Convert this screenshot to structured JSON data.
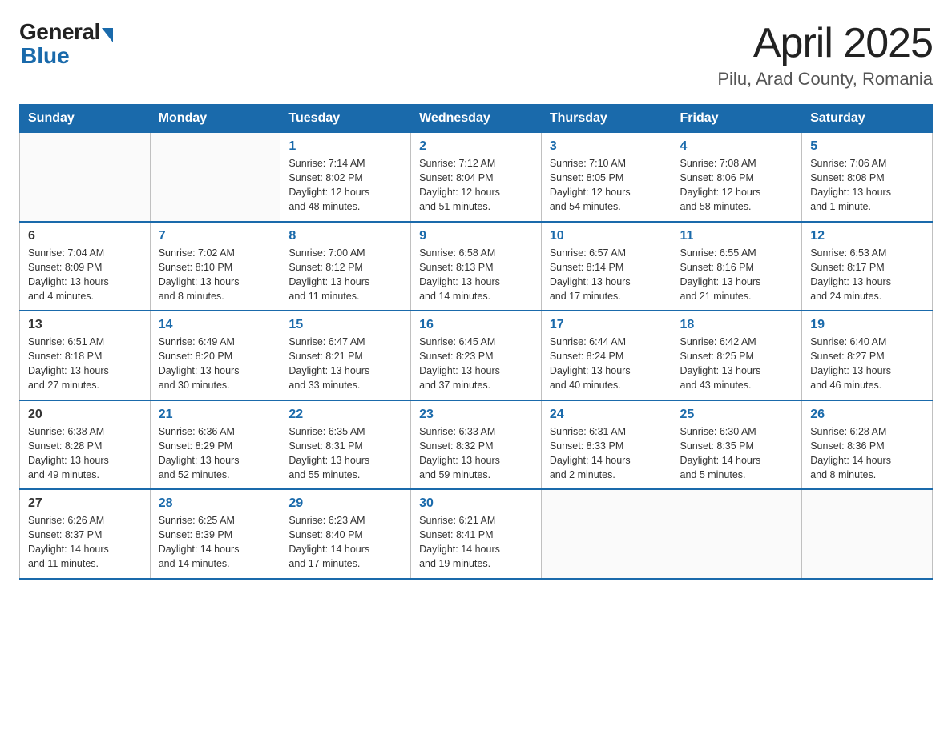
{
  "header": {
    "logo_general": "General",
    "logo_blue": "Blue",
    "month_title": "April 2025",
    "location": "Pilu, Arad County, Romania"
  },
  "days_of_week": [
    "Sunday",
    "Monday",
    "Tuesday",
    "Wednesday",
    "Thursday",
    "Friday",
    "Saturday"
  ],
  "weeks": [
    [
      {
        "day": "",
        "info": ""
      },
      {
        "day": "",
        "info": ""
      },
      {
        "day": "1",
        "info": "Sunrise: 7:14 AM\nSunset: 8:02 PM\nDaylight: 12 hours\nand 48 minutes."
      },
      {
        "day": "2",
        "info": "Sunrise: 7:12 AM\nSunset: 8:04 PM\nDaylight: 12 hours\nand 51 minutes."
      },
      {
        "day": "3",
        "info": "Sunrise: 7:10 AM\nSunset: 8:05 PM\nDaylight: 12 hours\nand 54 minutes."
      },
      {
        "day": "4",
        "info": "Sunrise: 7:08 AM\nSunset: 8:06 PM\nDaylight: 12 hours\nand 58 minutes."
      },
      {
        "day": "5",
        "info": "Sunrise: 7:06 AM\nSunset: 8:08 PM\nDaylight: 13 hours\nand 1 minute."
      }
    ],
    [
      {
        "day": "6",
        "info": "Sunrise: 7:04 AM\nSunset: 8:09 PM\nDaylight: 13 hours\nand 4 minutes."
      },
      {
        "day": "7",
        "info": "Sunrise: 7:02 AM\nSunset: 8:10 PM\nDaylight: 13 hours\nand 8 minutes."
      },
      {
        "day": "8",
        "info": "Sunrise: 7:00 AM\nSunset: 8:12 PM\nDaylight: 13 hours\nand 11 minutes."
      },
      {
        "day": "9",
        "info": "Sunrise: 6:58 AM\nSunset: 8:13 PM\nDaylight: 13 hours\nand 14 minutes."
      },
      {
        "day": "10",
        "info": "Sunrise: 6:57 AM\nSunset: 8:14 PM\nDaylight: 13 hours\nand 17 minutes."
      },
      {
        "day": "11",
        "info": "Sunrise: 6:55 AM\nSunset: 8:16 PM\nDaylight: 13 hours\nand 21 minutes."
      },
      {
        "day": "12",
        "info": "Sunrise: 6:53 AM\nSunset: 8:17 PM\nDaylight: 13 hours\nand 24 minutes."
      }
    ],
    [
      {
        "day": "13",
        "info": "Sunrise: 6:51 AM\nSunset: 8:18 PM\nDaylight: 13 hours\nand 27 minutes."
      },
      {
        "day": "14",
        "info": "Sunrise: 6:49 AM\nSunset: 8:20 PM\nDaylight: 13 hours\nand 30 minutes."
      },
      {
        "day": "15",
        "info": "Sunrise: 6:47 AM\nSunset: 8:21 PM\nDaylight: 13 hours\nand 33 minutes."
      },
      {
        "day": "16",
        "info": "Sunrise: 6:45 AM\nSunset: 8:23 PM\nDaylight: 13 hours\nand 37 minutes."
      },
      {
        "day": "17",
        "info": "Sunrise: 6:44 AM\nSunset: 8:24 PM\nDaylight: 13 hours\nand 40 minutes."
      },
      {
        "day": "18",
        "info": "Sunrise: 6:42 AM\nSunset: 8:25 PM\nDaylight: 13 hours\nand 43 minutes."
      },
      {
        "day": "19",
        "info": "Sunrise: 6:40 AM\nSunset: 8:27 PM\nDaylight: 13 hours\nand 46 minutes."
      }
    ],
    [
      {
        "day": "20",
        "info": "Sunrise: 6:38 AM\nSunset: 8:28 PM\nDaylight: 13 hours\nand 49 minutes."
      },
      {
        "day": "21",
        "info": "Sunrise: 6:36 AM\nSunset: 8:29 PM\nDaylight: 13 hours\nand 52 minutes."
      },
      {
        "day": "22",
        "info": "Sunrise: 6:35 AM\nSunset: 8:31 PM\nDaylight: 13 hours\nand 55 minutes."
      },
      {
        "day": "23",
        "info": "Sunrise: 6:33 AM\nSunset: 8:32 PM\nDaylight: 13 hours\nand 59 minutes."
      },
      {
        "day": "24",
        "info": "Sunrise: 6:31 AM\nSunset: 8:33 PM\nDaylight: 14 hours\nand 2 minutes."
      },
      {
        "day": "25",
        "info": "Sunrise: 6:30 AM\nSunset: 8:35 PM\nDaylight: 14 hours\nand 5 minutes."
      },
      {
        "day": "26",
        "info": "Sunrise: 6:28 AM\nSunset: 8:36 PM\nDaylight: 14 hours\nand 8 minutes."
      }
    ],
    [
      {
        "day": "27",
        "info": "Sunrise: 6:26 AM\nSunset: 8:37 PM\nDaylight: 14 hours\nand 11 minutes."
      },
      {
        "day": "28",
        "info": "Sunrise: 6:25 AM\nSunset: 8:39 PM\nDaylight: 14 hours\nand 14 minutes."
      },
      {
        "day": "29",
        "info": "Sunrise: 6:23 AM\nSunset: 8:40 PM\nDaylight: 14 hours\nand 17 minutes."
      },
      {
        "day": "30",
        "info": "Sunrise: 6:21 AM\nSunset: 8:41 PM\nDaylight: 14 hours\nand 19 minutes."
      },
      {
        "day": "",
        "info": ""
      },
      {
        "day": "",
        "info": ""
      },
      {
        "day": "",
        "info": ""
      }
    ]
  ]
}
